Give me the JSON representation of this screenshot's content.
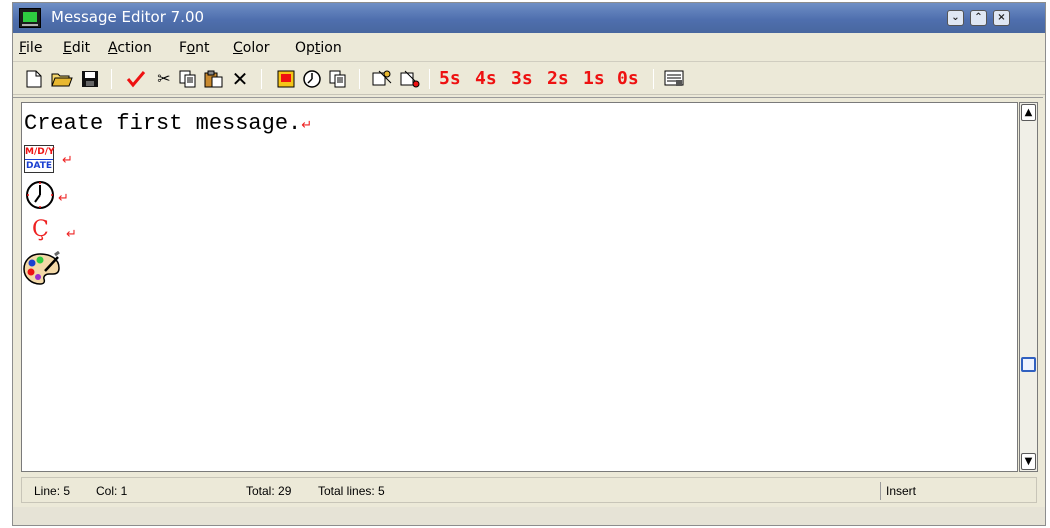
{
  "window": {
    "title": "Message Editor 7.00"
  },
  "menu": [
    {
      "name": "menu-file",
      "label": "File",
      "key": "F",
      "rest": "ile"
    },
    {
      "name": "menu-edit",
      "label": "Edit",
      "key": "E",
      "rest": "dit"
    },
    {
      "name": "menu-action",
      "label": "Action",
      "key": "A",
      "rest": "ction"
    },
    {
      "name": "menu-font",
      "label": "Font",
      "pre": "F",
      "key": "o",
      "rest": "nt"
    },
    {
      "name": "menu-color",
      "label": "Color",
      "key": "C",
      "rest": "olor"
    },
    {
      "name": "menu-option",
      "label": "Option",
      "pre": "Op",
      "key": "t",
      "rest": "ion"
    }
  ],
  "toolbar": {
    "icons": [
      "new-document-icon",
      "open-folder-icon",
      "save-disk-icon",
      "check-icon",
      "cut-scissors-icon",
      "copy-icon",
      "paste-icon",
      "delete-x-icon",
      "date-insert-icon",
      "clock-insert-icon",
      "copy-special-icon",
      "special-char-icon",
      "color-palette-icon",
      "message-icon"
    ],
    "delays": [
      "5s",
      "4s",
      "3s",
      "2s",
      "1s",
      "0s"
    ]
  },
  "editor": {
    "line1": "Create first message.",
    "date_top": "M/D/Y",
    "date_bottom": "DATE",
    "special_char": "Ç",
    "return_mark": "↵"
  },
  "status": {
    "line": "Line: 5",
    "col": "Col: 1",
    "total": "Total: 29",
    "total_lines": "Total lines: 5",
    "mode": "Insert"
  }
}
